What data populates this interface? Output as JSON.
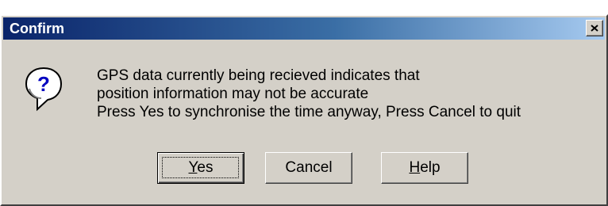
{
  "dialog": {
    "title": "Confirm",
    "icon": "question-icon",
    "message_lines": [
      "GPS data currently being recieved indicates that",
      "position information may not be accurate",
      "Press Yes to synchronise the time anyway, Press Cancel to quit"
    ],
    "buttons": {
      "yes": {
        "mnemonic": "Y",
        "rest": "es"
      },
      "cancel": {
        "label": "Cancel"
      },
      "help": {
        "mnemonic": "H",
        "rest": "elp"
      }
    }
  },
  "colors": {
    "titlebar_start": "#0a246a",
    "titlebar_end": "#a6caf0",
    "face": "#d4d0c8",
    "icon_blue": "#0000c0"
  }
}
